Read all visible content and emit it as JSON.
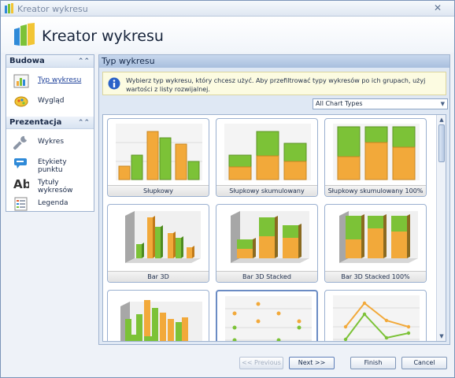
{
  "window": {
    "title": "Kreator wykresu",
    "close_glyph": "✕"
  },
  "header": {
    "title": "Kreator wykresu"
  },
  "nav": {
    "groups": [
      {
        "label": "Budowa",
        "collapse_glyph": "⌃⌃",
        "items": [
          {
            "label": "Typ wykresu",
            "icon": "bar-chart-icon"
          },
          {
            "label": "Wygląd",
            "icon": "palette-icon"
          }
        ]
      },
      {
        "label": "Prezentacja",
        "collapse_glyph": "⌃⌃",
        "items": [
          {
            "label": "Wykres",
            "icon": "wrench-icon"
          },
          {
            "label": "Etykiety punktu",
            "icon": "point-labels-icon"
          },
          {
            "label": "Tytuły wykresów",
            "icon": "text-ab-icon"
          },
          {
            "label": "Legenda",
            "icon": "legend-icon"
          }
        ]
      }
    ]
  },
  "panel": {
    "title": "Typ wykresu",
    "info": "Wybierz typ wykresu, który chcesz użyć. Aby przefiltrować typy wykresów po ich grupach, użyj wartości z listy rozwijalnej.",
    "filter": {
      "selected": "All Chart Types",
      "arrow": "▼"
    },
    "scroll": {
      "up": "▲",
      "down": "▼"
    },
    "tiles": [
      {
        "label": "Słupkowy"
      },
      {
        "label": "Słupkowy skumulowany"
      },
      {
        "label": "Słupkowy skumulowany 100%"
      },
      {
        "label": "Bar 3D"
      },
      {
        "label": "Bar 3D Stacked"
      },
      {
        "label": "Bar 3D Stacked 100%"
      }
    ]
  },
  "buttons": {
    "previous": "<< Previous",
    "next": "Next >>",
    "finish": "Finish",
    "cancel": "Cancel"
  },
  "colors": {
    "orange": "#f2a93a",
    "green": "#7cc237",
    "accent": "#5c7eb8"
  }
}
